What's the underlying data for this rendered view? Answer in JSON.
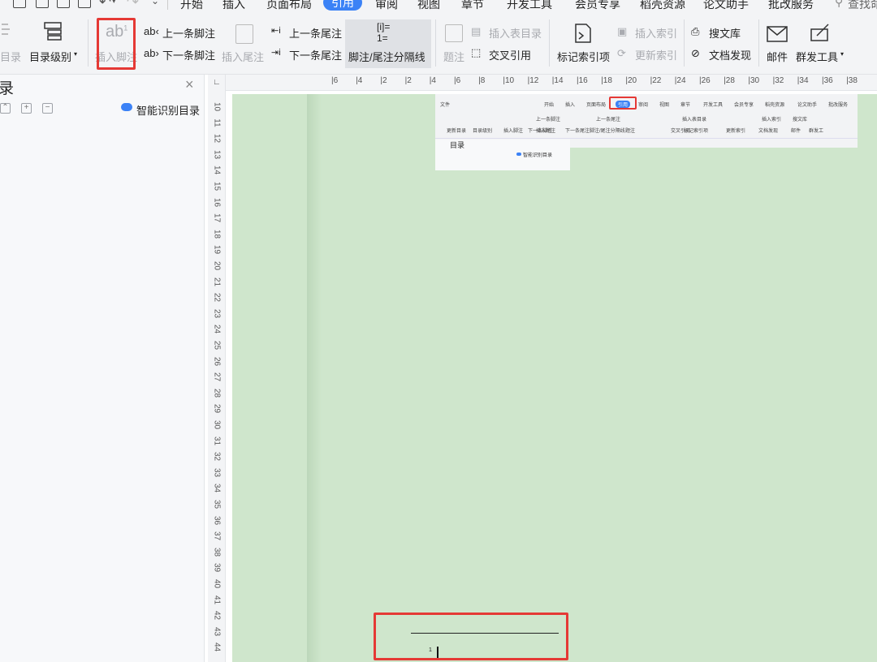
{
  "menubar": {
    "tabs": [
      "开始",
      "插入",
      "页面布局",
      "引用",
      "审阅",
      "视图",
      "章节",
      "开发工具",
      "会员专享",
      "稻壳资源",
      "论文助手",
      "批改服务"
    ],
    "active_tab": "引用",
    "search_label": "查找命",
    "accent": "#3b82f6"
  },
  "ribbon": {
    "toc_label": "目录",
    "toc_level": "目录级别",
    "insert_footnote": "插入脚注",
    "prev_footnote": "上一条脚注",
    "next_footnote": "下一条脚注",
    "insert_endnote": "插入尾注",
    "prev_endnote": "上一条尾注",
    "next_endnote": "下一条尾注",
    "separator": "脚注/尾注分隔线",
    "caption": "题注",
    "insert_table_toc": "插入表目录",
    "cross_ref": "交叉引用",
    "mark_index": "标记索引项",
    "insert_index": "插入索引",
    "update_index": "更新索引",
    "search_lib": "搜文库",
    "doc_discover": "文档发现",
    "mail": "邮件",
    "mass_tools": "群发工具"
  },
  "toc_panel": {
    "title": "录",
    "close": "×",
    "smart_toc": "智能识别目录"
  },
  "ruler": {
    "horizontal": [
      "6",
      "4",
      "2",
      "2",
      "4",
      "6",
      "8",
      "10",
      "12",
      "14",
      "16",
      "18",
      "20",
      "22",
      "24",
      "26",
      "28",
      "30",
      "32",
      "34",
      "36",
      "38"
    ],
    "vertical": [
      "10",
      "11",
      "12",
      "13",
      "14",
      "15",
      "16",
      "17",
      "18",
      "19",
      "20",
      "21",
      "22",
      "23",
      "24",
      "25",
      "26",
      "27",
      "28",
      "29",
      "30",
      "31",
      "32",
      "33",
      "34",
      "35",
      "36",
      "37",
      "38",
      "39",
      "40",
      "41",
      "42",
      "43",
      "44"
    ]
  },
  "thumbnail": {
    "file": "文件",
    "tabs": [
      "开始",
      "插入",
      "页面布局",
      "引用",
      "审阅",
      "视图",
      "章节",
      "开发工具",
      "会员专享",
      "稻壳资源",
      "论文助手",
      "批改服务"
    ],
    "row1": [
      "上一条脚注",
      "上一条尾注",
      "插入表目录",
      "插入索引",
      "搜文库"
    ],
    "row2": [
      "更新目录",
      "目录级别",
      "插入脚注",
      "下一条脚注",
      "插入尾注",
      "下一条尾注",
      "脚注/尾注分隔线",
      "题注",
      "交叉引用",
      "标记索引项",
      "更新索引",
      "文档发现",
      "邮件",
      "群发工"
    ],
    "toc_title": "目录",
    "smart_toc": "智能识别目录"
  },
  "footnote": {
    "number": "1"
  },
  "highlight_color": "#e53935"
}
